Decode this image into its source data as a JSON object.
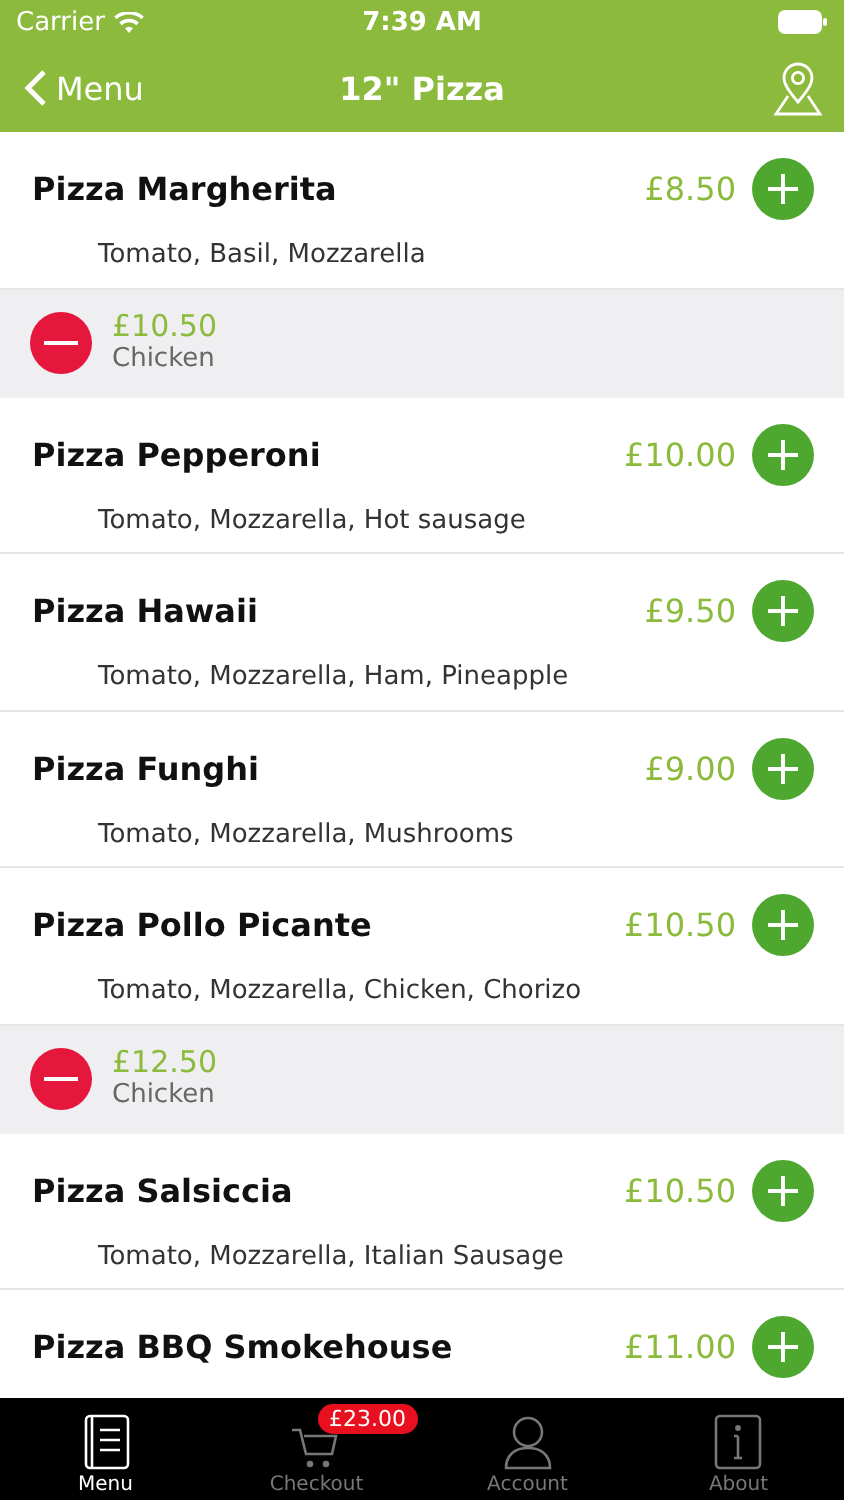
{
  "status_bar": {
    "carrier": "Carrier",
    "time": "7:39 AM"
  },
  "nav": {
    "back": "Menu",
    "title": "12\" Pizza"
  },
  "rows": [
    {
      "kind": "item",
      "name": "Pizza Margherita",
      "price": "£8.50",
      "description": "Tomato, Basil, Mozzarella"
    },
    {
      "kind": "added",
      "price": "£10.50",
      "option": "Chicken"
    },
    {
      "kind": "item",
      "name": "Pizza Pepperoni",
      "price": "£10.00",
      "description": "Tomato, Mozzarella, Hot sausage"
    },
    {
      "kind": "item",
      "name": "Pizza Hawaii",
      "price": "£9.50",
      "description": "Tomato, Mozzarella, Ham, Pineapple"
    },
    {
      "kind": "item",
      "name": "Pizza Funghi",
      "price": "£9.00",
      "description": "Tomato, Mozzarella, Mushrooms"
    },
    {
      "kind": "item",
      "name": "Pizza Pollo Picante",
      "price": "£10.50",
      "description": "Tomato, Mozzarella, Chicken, Chorizo"
    },
    {
      "kind": "added",
      "price": "£12.50",
      "option": "Chicken"
    },
    {
      "kind": "item",
      "name": "Pizza Salsiccia",
      "price": "£10.50",
      "description": "Tomato, Mozzarella, Italian Sausage"
    },
    {
      "kind": "item",
      "name": "Pizza BBQ Smokehouse",
      "price": "£11.00"
    }
  ],
  "tab_bar": [
    {
      "kind": "menu",
      "label": "Menu",
      "selected": true
    },
    {
      "kind": "cart",
      "label": "Checkout",
      "selected": false,
      "badge": "£23.00"
    },
    {
      "kind": "person",
      "label": "Account",
      "selected": false
    },
    {
      "kind": "info",
      "label": "About",
      "selected": false
    }
  ]
}
